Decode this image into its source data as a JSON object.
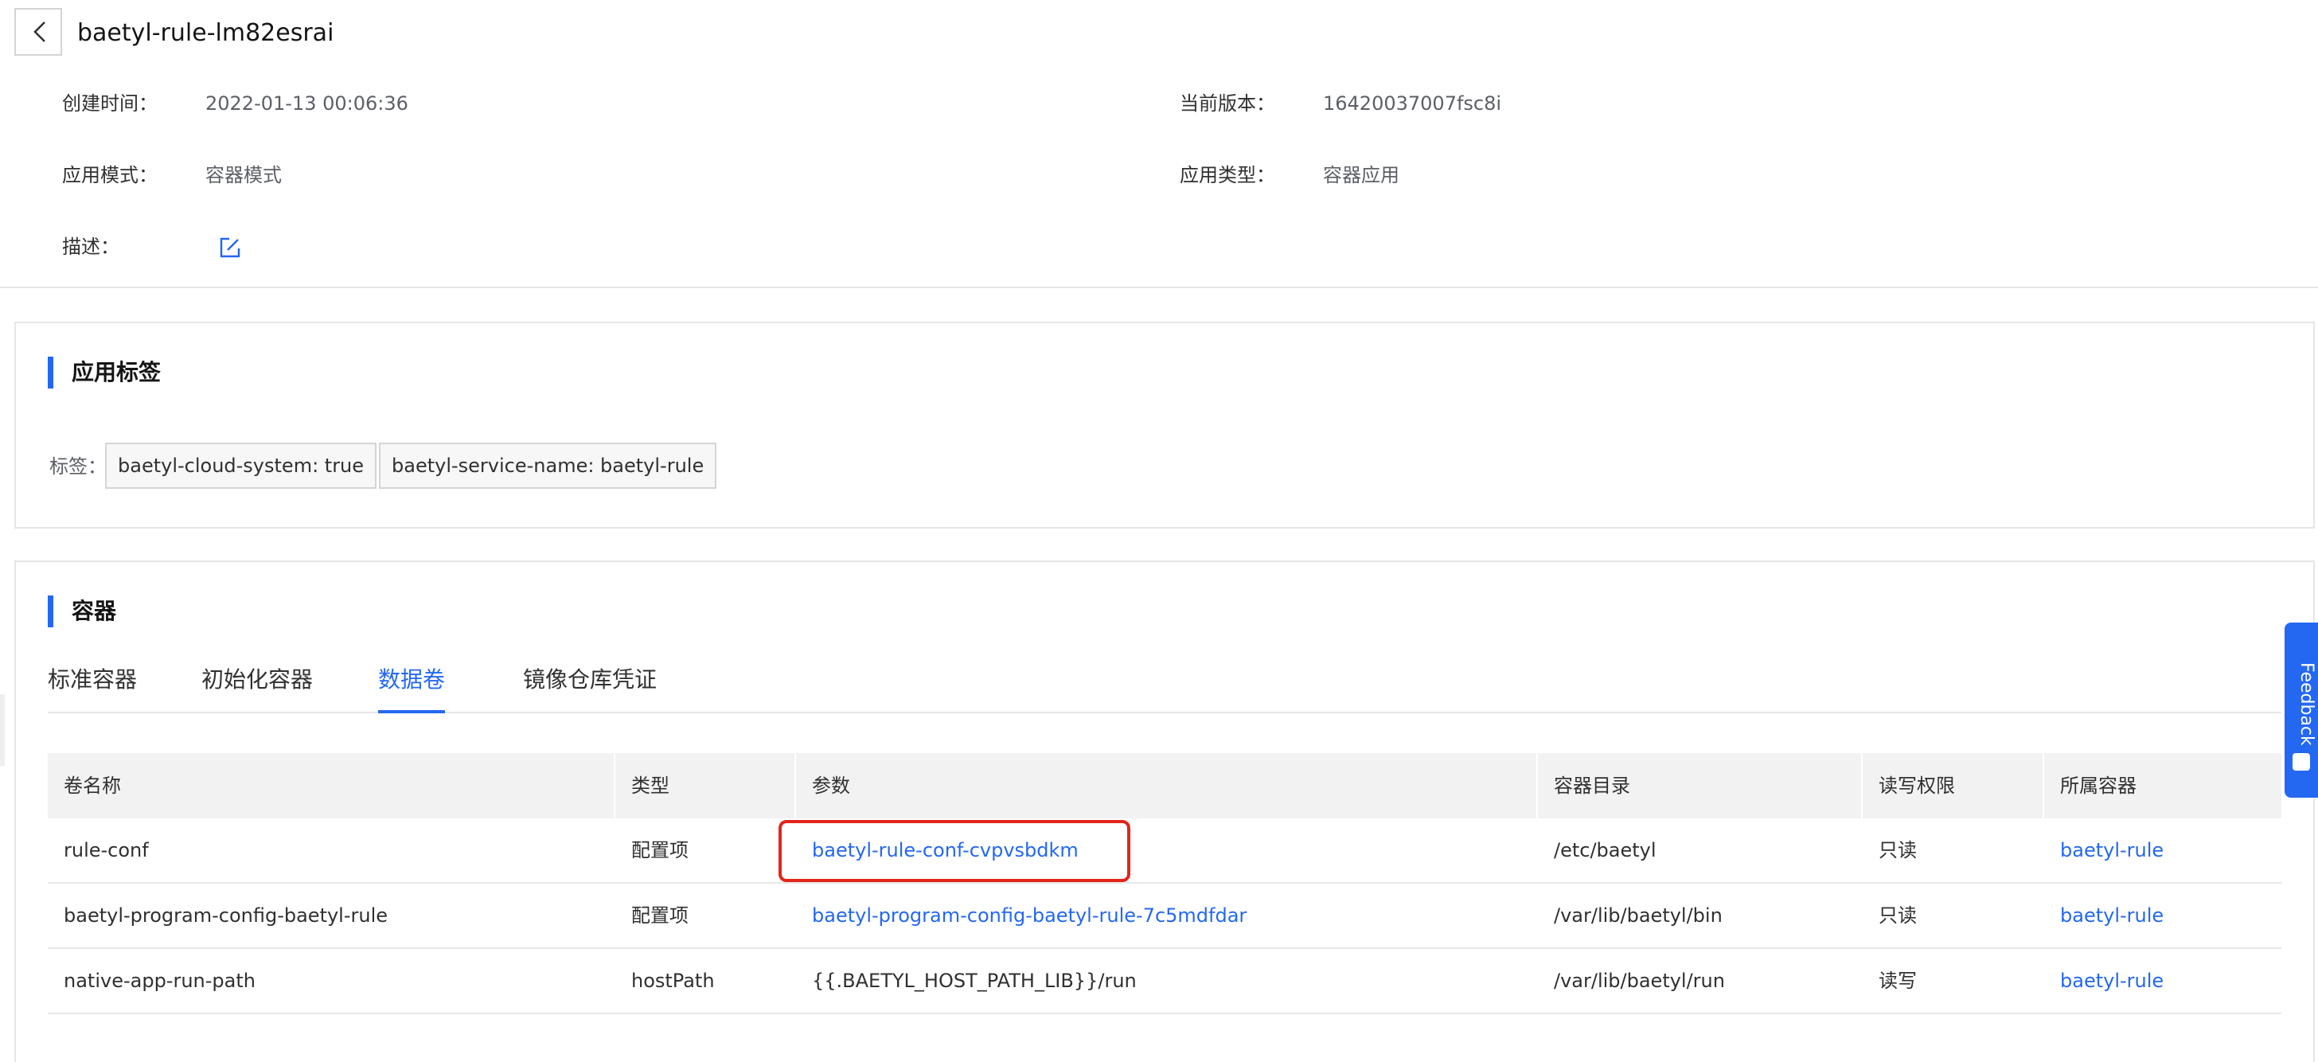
{
  "header": {
    "title": "baetyl-rule-lm82esrai"
  },
  "info": {
    "created_label": "创建时间：",
    "created_value": "2022-01-13 00:06:36",
    "version_label": "当前版本：",
    "version_value": "16420037007fsc8i",
    "mode_label": "应用模式：",
    "mode_value": "容器模式",
    "type_label": "应用类型：",
    "type_value": "容器应用",
    "desc_label": "描述："
  },
  "labels_panel": {
    "title": "应用标签",
    "tags_label": "标签：",
    "tags": [
      "baetyl-cloud-system: true",
      "baetyl-service-name: baetyl-rule"
    ]
  },
  "containers_panel": {
    "title": "容器",
    "tabs": [
      {
        "label": "标准容器"
      },
      {
        "label": "初始化容器"
      },
      {
        "label": "数据卷"
      },
      {
        "label": "镜像仓库凭证"
      }
    ],
    "active_tab": "数据卷",
    "table": {
      "columns": [
        "卷名称",
        "类型",
        "参数",
        "容器目录",
        "读写权限",
        "所属容器"
      ],
      "rows": [
        {
          "name": "rule-conf",
          "type": "配置项",
          "param": "baetyl-rule-conf-cvpvsbdkm",
          "dir": "/etc/baetyl",
          "perm": "只读",
          "container": "baetyl-rule"
        },
        {
          "name": "baetyl-program-config-baetyl-rule",
          "type": "配置项",
          "param": "baetyl-program-config-baetyl-rule-7c5mdfdar",
          "dir": "/var/lib/baetyl/bin",
          "perm": "只读",
          "container": "baetyl-rule"
        },
        {
          "name": "native-app-run-path",
          "type": "hostPath",
          "param": "{{.BAETYL_HOST_PATH_LIB}}/run",
          "dir": "/var/lib/baetyl/run",
          "perm": "读写",
          "container": "baetyl-rule"
        }
      ]
    }
  },
  "feedback": {
    "label": "Feedback"
  },
  "colors": {
    "accent": "#2468f2",
    "highlight": "#e3251b",
    "border": "#e6e6e6"
  }
}
